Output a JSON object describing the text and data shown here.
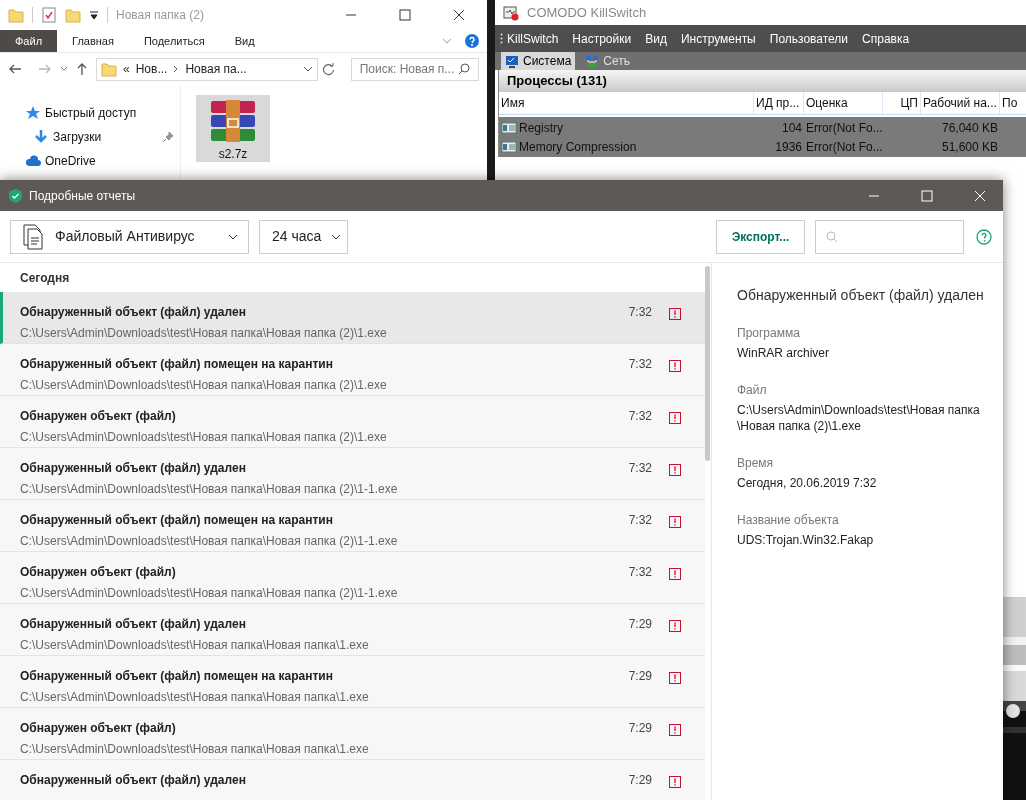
{
  "explorer": {
    "title": "Новая папка (2)",
    "ribbon_tabs": [
      {
        "label": "Файл",
        "selected": true
      },
      {
        "label": "Главная",
        "selected": false
      },
      {
        "label": "Поделиться",
        "selected": false
      },
      {
        "label": "Вид",
        "selected": false
      }
    ],
    "breadcrumb_overflow": "«",
    "breadcrumb": [
      "Нов...",
      "Новая па..."
    ],
    "search": {
      "placeholder": "Поиск: Новая п..."
    },
    "nav_items": [
      {
        "label": "Быстрый доступ",
        "kind": "star",
        "pinned": false
      },
      {
        "label": "Загрузки",
        "kind": "download",
        "pinned": true
      },
      {
        "label": "OneDrive",
        "kind": "cloud",
        "pinned": false
      }
    ],
    "files": [
      {
        "name": "s2.7z",
        "selected": true
      }
    ]
  },
  "killswitch": {
    "title": "COMODO KillSwitch",
    "menu": [
      "KillSwitch",
      "Настройки",
      "Вид",
      "Инструменты",
      "Пользователи",
      "Справка"
    ],
    "tabs": [
      {
        "label": "Система",
        "selected": true
      },
      {
        "label": "Сеть",
        "selected": false
      }
    ],
    "panel_title": "Процессы (131)",
    "columns": [
      "Имя",
      "ИД пр...",
      "Оценка",
      "ЦП",
      "Рабочий на...",
      "По"
    ],
    "rows": [
      {
        "name": "Registry",
        "pid": "104",
        "rating": "Error(Not Fo...",
        "memory": "76,040 KB"
      },
      {
        "name": "Memory Compression",
        "pid": "1936",
        "rating": "Error(Not Fo...",
        "memory": "51,600 KB"
      }
    ]
  },
  "reports": {
    "title": "Подробные отчеты",
    "component": "Файловый Антивирус",
    "period": "24 часа",
    "export_button": "Экспорт...",
    "group": "Сегодня",
    "events": [
      {
        "title": "Обнаруженный объект (файл) удален",
        "path": "C:\\Users\\Admin\\Downloads\\test\\Новая папка\\Новая папка (2)\\1.exe",
        "time": "7:32",
        "selected": true
      },
      {
        "title": "Обнаруженный объект (файл) помещен на карантин",
        "path": "C:\\Users\\Admin\\Downloads\\test\\Новая папка\\Новая папка (2)\\1.exe",
        "time": "7:32",
        "selected": false
      },
      {
        "title": "Обнаружен объект (файл)",
        "path": "C:\\Users\\Admin\\Downloads\\test\\Новая папка\\Новая папка (2)\\1.exe",
        "time": "7:32",
        "selected": false
      },
      {
        "title": "Обнаруженный объект (файл) удален",
        "path": "C:\\Users\\Admin\\Downloads\\test\\Новая папка\\Новая папка (2)\\1-1.exe",
        "time": "7:32",
        "selected": false
      },
      {
        "title": "Обнаруженный объект (файл) помещен на карантин",
        "path": "C:\\Users\\Admin\\Downloads\\test\\Новая папка\\Новая папка (2)\\1-1.exe",
        "time": "7:32",
        "selected": false
      },
      {
        "title": "Обнаружен объект (файл)",
        "path": "C:\\Users\\Admin\\Downloads\\test\\Новая папка\\Новая папка (2)\\1-1.exe",
        "time": "7:32",
        "selected": false
      },
      {
        "title": "Обнаруженный объект (файл) удален",
        "path": "C:\\Users\\Admin\\Downloads\\test\\Новая папка\\Новая папка\\1.exe",
        "time": "7:29",
        "selected": false
      },
      {
        "title": "Обнаруженный объект (файл) помещен на карантин",
        "path": "C:\\Users\\Admin\\Downloads\\test\\Новая папка\\Новая папка\\1.exe",
        "time": "7:29",
        "selected": false
      },
      {
        "title": "Обнаружен объект (файл)",
        "path": "C:\\Users\\Admin\\Downloads\\test\\Новая папка\\Новая папка\\1.exe",
        "time": "7:29",
        "selected": false
      },
      {
        "title": "Обнаруженный объект (файл) удален",
        "time": "7:29",
        "selected": false
      }
    ],
    "details": {
      "title": "Обнаруженный объект (файл) удален",
      "fields": [
        {
          "label": "Программа",
          "value": "WinRAR archiver"
        },
        {
          "label": "Файл",
          "value": "C:\\Users\\Admin\\Downloads\\test\\Новая папка \\Новая папка (2)\\1.exe"
        },
        {
          "label": "Время",
          "value": "Сегодня, 20.06.2019 7:32"
        },
        {
          "label": "Название объекта",
          "value": "UDS:Trojan.Win32.Fakap"
        }
      ]
    }
  }
}
